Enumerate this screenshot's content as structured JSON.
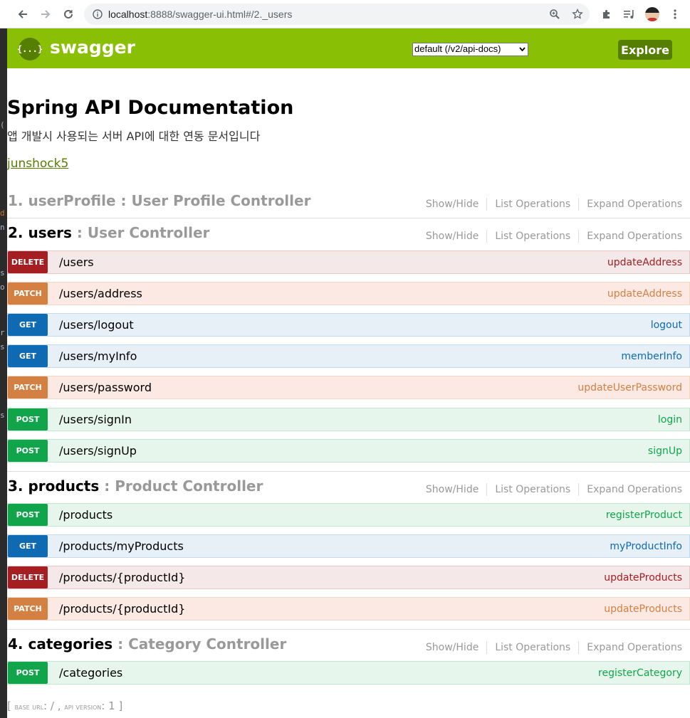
{
  "browser": {
    "url_host": "localhost",
    "url_rest": ":8888/swagger-ui.html#/2._users"
  },
  "header": {
    "logo_text": "swagger",
    "logo_symbol": "{...}",
    "api_selector": "default (/v2/api-docs)",
    "explore_label": "Explore"
  },
  "info": {
    "title": "Spring API Documentation",
    "description": "앱 개발시 사용되는 서버 API에 대한 연동 문서입니다",
    "contact": "junshock5"
  },
  "links": {
    "show_hide": "Show/Hide",
    "list_operations": "List Operations",
    "expand_operations": "Expand Operations"
  },
  "resources": [
    {
      "name": "1. userProfile",
      "controller": " : User Profile Controller",
      "operations": []
    },
    {
      "name": "2. users",
      "controller": " : User Controller",
      "operations": [
        {
          "method": "DELETE",
          "path": "/users",
          "op_id": "updateAddress"
        },
        {
          "method": "PATCH",
          "path": "/users/address",
          "op_id": "updateAddress"
        },
        {
          "method": "GET",
          "path": "/users/logout",
          "op_id": "logout"
        },
        {
          "method": "GET",
          "path": "/users/myInfo",
          "op_id": "memberInfo"
        },
        {
          "method": "PATCH",
          "path": "/users/password",
          "op_id": "updateUserPassword"
        },
        {
          "method": "POST",
          "path": "/users/signIn",
          "op_id": "login"
        },
        {
          "method": "POST",
          "path": "/users/signUp",
          "op_id": "signUp"
        }
      ]
    },
    {
      "name": "3. products",
      "controller": " : Product Controller",
      "operations": [
        {
          "method": "POST",
          "path": "/products",
          "op_id": "registerProduct"
        },
        {
          "method": "GET",
          "path": "/products/myProducts",
          "op_id": "myProductInfo"
        },
        {
          "method": "DELETE",
          "path": "/products/{productId}",
          "op_id": "updateProducts"
        },
        {
          "method": "PATCH",
          "path": "/products/{productId}",
          "op_id": "updateProducts"
        }
      ]
    },
    {
      "name": "4. categories",
      "controller": " : Category Controller",
      "operations": [
        {
          "method": "POST",
          "path": "/categories",
          "op_id": "registerCategory"
        }
      ]
    }
  ],
  "footer": {
    "open": "[ ",
    "base_url_label": "base url",
    "base_url_value": ": / , ",
    "api_version_label": "api version",
    "api_version_value": ": 1 ]"
  },
  "colors": {
    "header_bg": "#89bf04",
    "delete": "#a41e22",
    "patch": "#d38042",
    "get": "#0f6ab4",
    "post": "#10a54a"
  }
}
